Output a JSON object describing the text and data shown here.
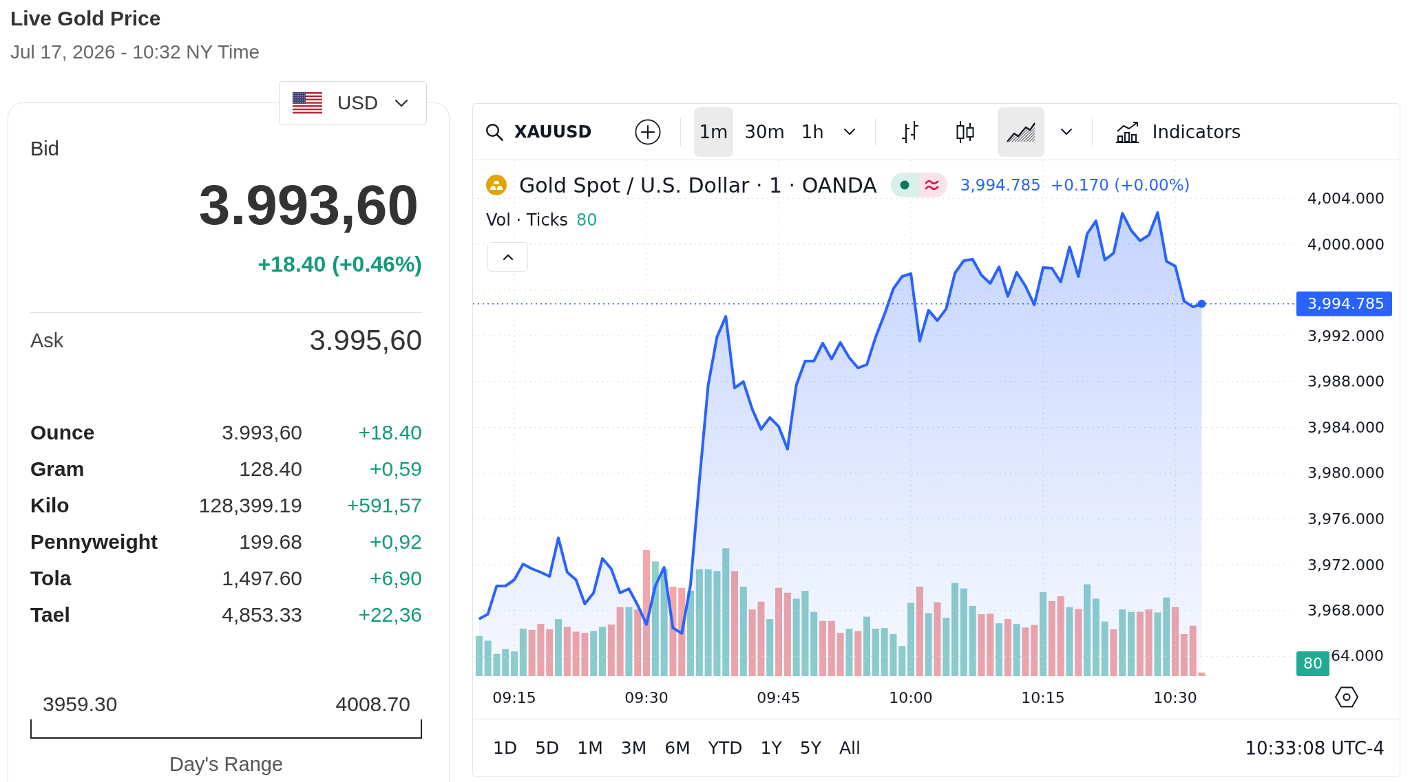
{
  "header": {
    "title": "Live Gold Price",
    "timestamp": "Jul 17, 2026 - 10:32 NY Time"
  },
  "quote_panel": {
    "currency": {
      "label": "USD"
    },
    "bid": {
      "label": "Bid",
      "price": "3.993,60",
      "change": "+18.40 (+0.46%)",
      "positive": true
    },
    "ask": {
      "label": "Ask",
      "price": "3.995,60"
    },
    "units": [
      {
        "name": "Ounce",
        "price": "3.993,60",
        "change": "+18.40",
        "positive": true
      },
      {
        "name": "Gram",
        "price": "128.40",
        "change": "+0,59",
        "positive": true
      },
      {
        "name": "Kilo",
        "price": "128,399.19",
        "change": "+591,57",
        "positive": true
      },
      {
        "name": "Pennyweight",
        "price": "199.68",
        "change": "+0,92",
        "positive": true
      },
      {
        "name": "Tola",
        "price": "1,497.60",
        "change": "+6,90",
        "positive": true
      },
      {
        "name": "Tael",
        "price": "4,853.33",
        "change": "+22,36",
        "positive": true
      }
    ],
    "day_range": {
      "low": "3959.30",
      "high": "4008.70",
      "label": "Day's Range"
    }
  },
  "chart_widget": {
    "toolbar": {
      "symbol": "XAUUSD",
      "intervals": [
        {
          "label": "1m",
          "selected": true
        },
        {
          "label": "30m",
          "selected": false
        },
        {
          "label": "1h",
          "selected": false
        }
      ],
      "chart_styles": [
        {
          "kind": "bars",
          "selected": false
        },
        {
          "kind": "candles",
          "selected": false
        },
        {
          "kind": "area",
          "selected": true
        }
      ],
      "indicators_label": "Indicators"
    },
    "legend": {
      "last": "3,994.785",
      "change": "+0.170 (+0.00%)",
      "volume_label": "Vol · Ticks",
      "volume_value": "80"
    },
    "chart_data": {
      "type": "area",
      "series": [
        {
          "name": "Gold Spot / U.S. Dollar · 1 · OANDA",
          "color": "#2962ff",
          "values": [
            3967.27,
            3967.69,
            3970.15,
            3970.15,
            3970.69,
            3972.07,
            3971.65,
            3971.35,
            3970.99,
            3974.35,
            3971.35,
            3970.69,
            3968.59,
            3969.55,
            3972.55,
            3971.65,
            3969.55,
            3969.91,
            3968.47,
            3966.79,
            3970.15,
            3971.77,
            3966.49,
            3966.01,
            3970.27,
            3979.28,
            3987.69,
            3991.89,
            3993.69,
            3987.45,
            3987.99,
            3985.59,
            3983.84,
            3984.86,
            3984.08,
            3982.1,
            3987.69,
            3989.79,
            3989.79,
            3991.35,
            3989.97,
            3991.41,
            3990.09,
            3989.19,
            3989.49,
            3991.89,
            3993.87,
            3996.1,
            3997.18,
            3997.42,
            3991.53,
            3994.23,
            3993.33,
            3994.35,
            3997.48,
            3998.56,
            3998.68,
            3997.3,
            3996.58,
            3998.02,
            3995.44,
            3997.54,
            3996.34,
            3994.71,
            3997.96,
            3997.9,
            3996.7,
            3999.76,
            3997.18,
            4000.9,
            4002.04,
            3998.62,
            3999.22,
            4002.7,
            4001.2,
            4000.3,
            4000.78,
            4002.76,
            3998.5,
            3998.08,
            3995.02,
            3994.53,
            3994.785
          ]
        }
      ],
      "x": [
        551,
        552,
        553,
        554,
        555,
        556,
        557,
        558,
        559,
        560,
        561,
        562,
        563,
        564,
        565,
        566,
        567,
        568,
        569,
        570,
        571,
        572,
        573,
        574,
        575,
        576,
        577,
        578,
        579,
        580,
        581,
        582,
        583,
        584,
        585,
        586,
        587,
        588,
        589,
        590,
        591,
        592,
        593,
        594,
        595,
        596,
        597,
        598,
        599,
        600,
        601,
        602,
        603,
        604,
        605,
        606,
        607,
        608,
        609,
        610,
        611,
        612,
        613,
        614,
        615,
        616,
        617,
        618,
        619,
        620,
        621,
        622,
        623,
        624,
        625,
        626,
        627,
        628,
        629,
        630,
        631,
        632,
        633
      ],
      "xlim": [
        550.31,
        643.51
      ],
      "ylim": [
        3962.28,
        4007.33
      ],
      "xticks": [
        {
          "value": 555,
          "label": "09:15"
        },
        {
          "value": 570,
          "label": "09:30"
        },
        {
          "value": 585,
          "label": "09:45"
        },
        {
          "value": 600,
          "label": "10:00"
        },
        {
          "value": 615,
          "label": "10:15"
        },
        {
          "value": 630,
          "label": "10:30"
        }
      ],
      "yticks": [
        {
          "value": 4004,
          "label": "4,004.000"
        },
        {
          "value": 4000,
          "label": "4,000.000"
        },
        {
          "value": 3992,
          "label": "3,992.000"
        },
        {
          "value": 3988,
          "label": "3,988.000"
        },
        {
          "value": 3984,
          "label": "3,984.000"
        },
        {
          "value": 3980,
          "label": "3,980.000"
        },
        {
          "value": 3976,
          "label": "3,976.000"
        },
        {
          "value": 3972,
          "label": "3,972.000"
        },
        {
          "value": 3968,
          "label": "3,968.000"
        }
      ],
      "grid": true
    },
    "last_price_tag": "3,994.785",
    "covered_axis_label": "64.000",
    "volume_tag": "80",
    "ranges": [
      "1D",
      "5D",
      "1M",
      "3M",
      "6M",
      "YTD",
      "1Y",
      "5Y",
      "All"
    ],
    "clock": "10:33:08 UTC-4"
  }
}
